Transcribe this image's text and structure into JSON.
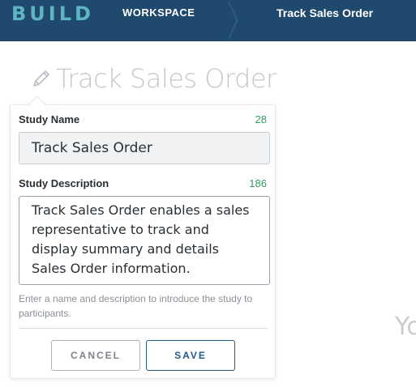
{
  "header": {
    "brand": "BUILD",
    "breadcrumbs": [
      "WORKSPACE",
      "Track Sales Order"
    ]
  },
  "page": {
    "title": "Track Sales Order",
    "background_text": "Yo"
  },
  "popover": {
    "study_name": {
      "label": "Study Name",
      "remaining": "28",
      "value": "Track Sales Order"
    },
    "study_description": {
      "label": "Study Description",
      "remaining": "186",
      "value": "Track Sales Order enables a sales representative to track and display summary and details Sales Order information."
    },
    "hint": "Enter a name and description to introduce the study to participants.",
    "cancel_label": "CANCEL",
    "save_label": "SAVE"
  },
  "colors": {
    "header_bg": "#1f4a6e",
    "brand": "#5fb3c2",
    "counter": "#2e9e5e",
    "primary": "#1f5a8c"
  }
}
